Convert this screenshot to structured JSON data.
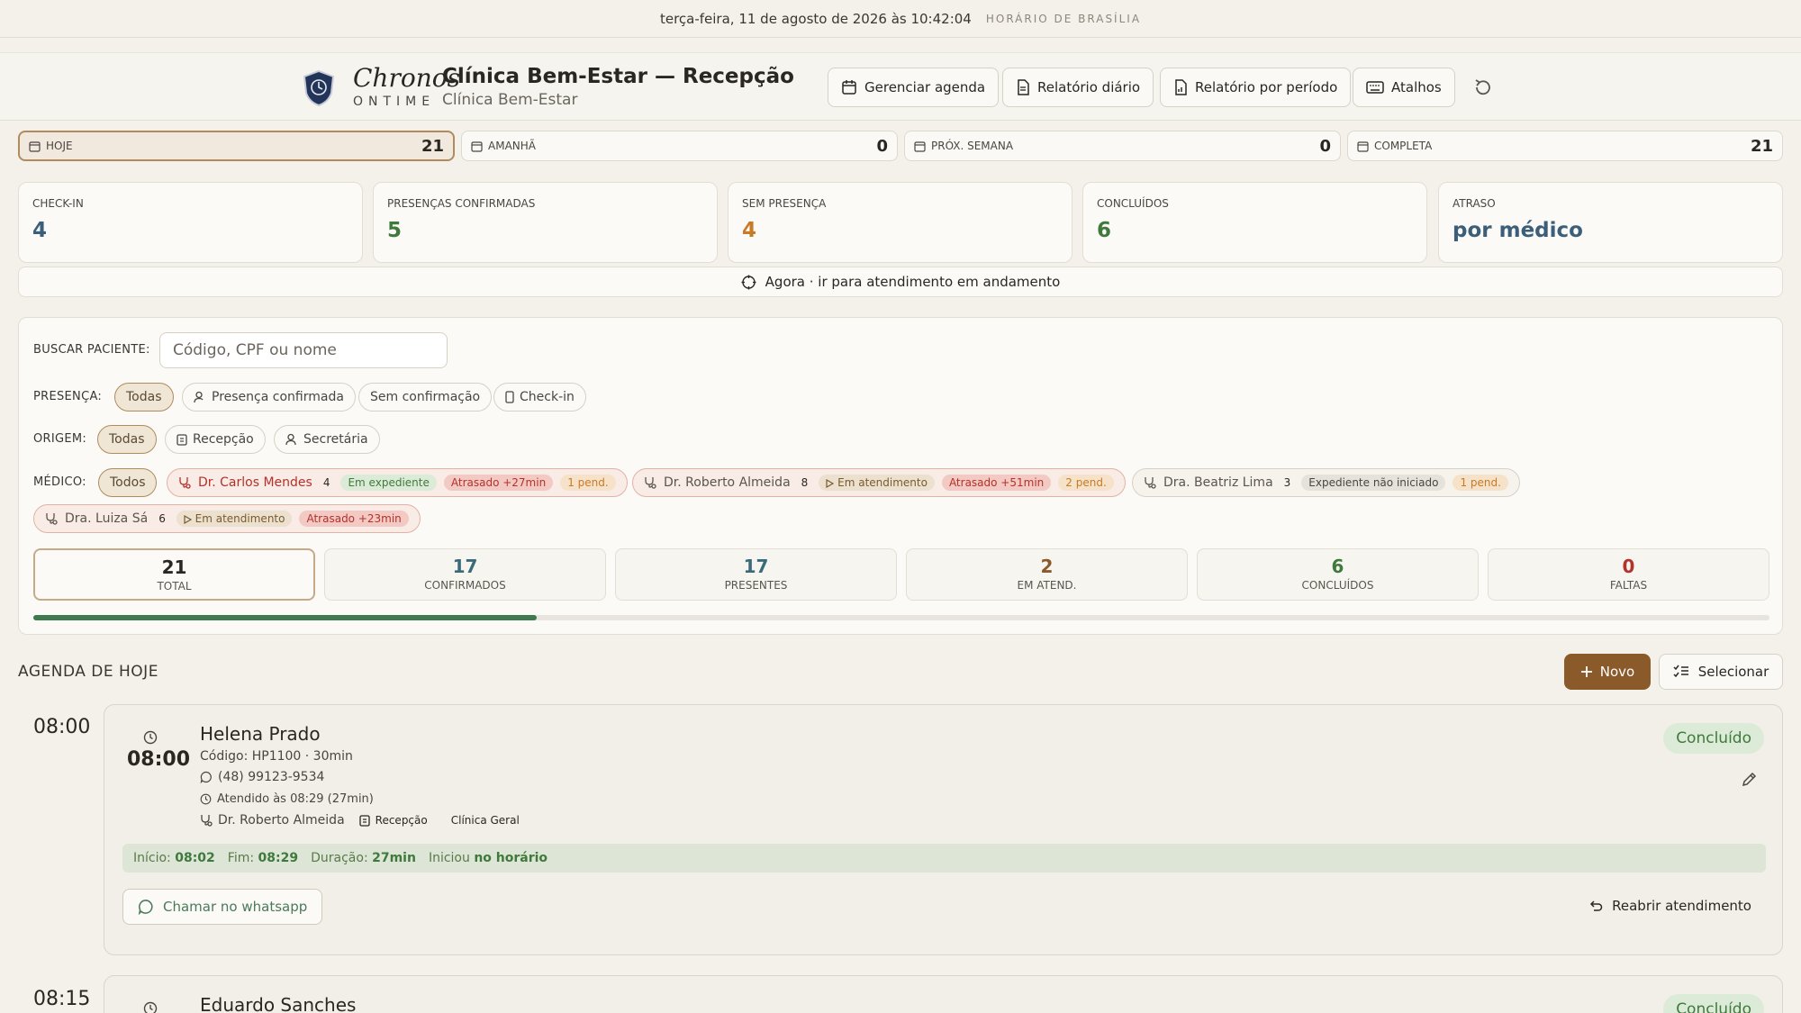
{
  "topbar": {
    "datetime": "terça-feira, 11 de agosto de 2026 às 10:42:04",
    "timezone": "HORÁRIO DE BRASÍLIA"
  },
  "brand": {
    "name": "Chronos",
    "sub": "ONTIME"
  },
  "clinic": {
    "title": "Clínica Bem-Estar — Recepção",
    "subtitle": "Clínica Bem-Estar"
  },
  "header_buttons": {
    "manage": "Gerenciar agenda",
    "daily": "Relatório diário",
    "period": "Relatório por período",
    "shortcuts": "Atalhos"
  },
  "range_tabs": [
    {
      "label": "HOJE",
      "count": "21"
    },
    {
      "label": "AMANHÃ",
      "count": "0"
    },
    {
      "label": "PRÓX. SEMANA",
      "count": "0"
    },
    {
      "label": "COMPLETA",
      "count": "21"
    }
  ],
  "stats": [
    {
      "label": "CHECK-IN",
      "value": "4",
      "color": "#3b5f7a"
    },
    {
      "label": "PRESENÇAS CONFIRMADAS",
      "value": "5",
      "color": "#3f7a3c"
    },
    {
      "label": "SEM PRESENÇA",
      "value": "4",
      "color": "#c87a26"
    },
    {
      "label": "CONCLUÍDOS",
      "value": "6",
      "color": "#3f7a3c"
    },
    {
      "label": "ATRASO",
      "value": "por médico",
      "color": "#3b5f7a"
    }
  ],
  "agora": "Agora · ir para atendimento em andamento",
  "filters": {
    "search_label": "BUSCAR PACIENTE:",
    "search_placeholder": "Código, CPF ou nome",
    "presenca_label": "PRESENÇA:",
    "presenca": [
      "Todas",
      "Presença confirmada",
      "Sem confirmação",
      "Check-in"
    ],
    "origem_label": "ORIGEM:",
    "origem": [
      "Todas",
      "Recepção",
      "Secretária"
    ],
    "medico_label": "MÉDICO:",
    "medico_all": "Todos",
    "doctors": [
      {
        "name": "Dr. Carlos Mendes",
        "count": "4",
        "status": "Em expediente",
        "delay": "Atrasado +27min",
        "pend": "1 pend."
      },
      {
        "name": "Dr. Roberto Almeida",
        "count": "8",
        "status": "Em atendimento",
        "delay": "Atrasado +51min",
        "pend": "2 pend."
      },
      {
        "name": "Dra. Beatriz Lima",
        "count": "3",
        "status": "Expediente não iniciado",
        "pend": "1 pend."
      },
      {
        "name": "Dra. Luiza Sá",
        "count": "6",
        "status": "Em atendimento",
        "delay": "Atrasado +23min"
      }
    ]
  },
  "summary": [
    {
      "value": "21",
      "label": "TOTAL",
      "color": "#2a2722"
    },
    {
      "value": "17",
      "label": "CONFIRMADOS",
      "color": "#3b6a7a"
    },
    {
      "value": "17",
      "label": "PRESENTES",
      "color": "#3b6a7a"
    },
    {
      "value": "2",
      "label": "EM ATEND.",
      "color": "#8b5a2b"
    },
    {
      "value": "6",
      "label": "CONCLUÍDOS",
      "color": "#3f7a3c"
    },
    {
      "value": "0",
      "label": "FALTAS",
      "color": "#b3322a"
    }
  ],
  "progress": 0.29,
  "agenda": {
    "title": "AGENDA DE HOJE",
    "new_label": "Novo",
    "select_label": "Selecionar",
    "items": [
      {
        "time": "08:00",
        "name": "Helena Prado",
        "code": "Código: HP1100 · 30min",
        "phone": "(48) 99123-9534",
        "attended": "Atendido às 08:29  (27min)",
        "doctor": "Dr. Roberto Almeida",
        "origin": "Recepção",
        "specialty": "Clínica Geral",
        "status": "Concluído",
        "inicio_label": "Início:",
        "inicio": "08:02",
        "fim_label": "Fim:",
        "fim": "08:29",
        "duracao_label": "Duração:",
        "duracao": "27min",
        "iniciou_label": "Iniciou",
        "iniciou": "no horário",
        "wa_label": "Chamar no whatsapp",
        "reopen_label": "Reabrir atendimento"
      },
      {
        "time": "08:15",
        "name": "Eduardo Sanches",
        "status": "Concluído"
      }
    ]
  }
}
